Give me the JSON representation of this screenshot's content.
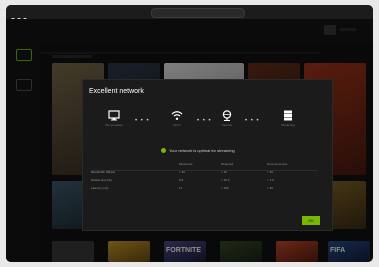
{
  "dialog": {
    "title": "Excellent network",
    "status_text": "Your network is optimal for streaming",
    "ok_label": "OK",
    "hops": [
      {
        "label": "My computer",
        "icon": "monitor-icon"
      },
      {
        "label": "Wi-Fi",
        "icon": "wifi-icon"
      },
      {
        "label": "Internet",
        "icon": "globe-icon"
      },
      {
        "label": "Streaming",
        "icon": "server-icon"
      }
    ],
    "table": {
      "headers": [
        "",
        "Measured",
        "Required",
        "Recommended"
      ],
      "rows": [
        [
          "Bandwidth (Mbps)",
          "> 40",
          "> 15",
          "> 25"
        ],
        [
          "Packet loss (%)",
          "0.0",
          "< 10.0",
          "< 1.0"
        ],
        [
          "Latency (ms)",
          "17",
          "< 150",
          "< 40"
        ]
      ]
    }
  },
  "library": {
    "bottom_tiles": [
      "",
      "",
      "FORTNITE",
      "",
      "",
      "FIFA"
    ]
  },
  "colors": {
    "accent": "#76b900",
    "dialog_bg": "#1b1b1b",
    "app_bg": "#121212"
  }
}
